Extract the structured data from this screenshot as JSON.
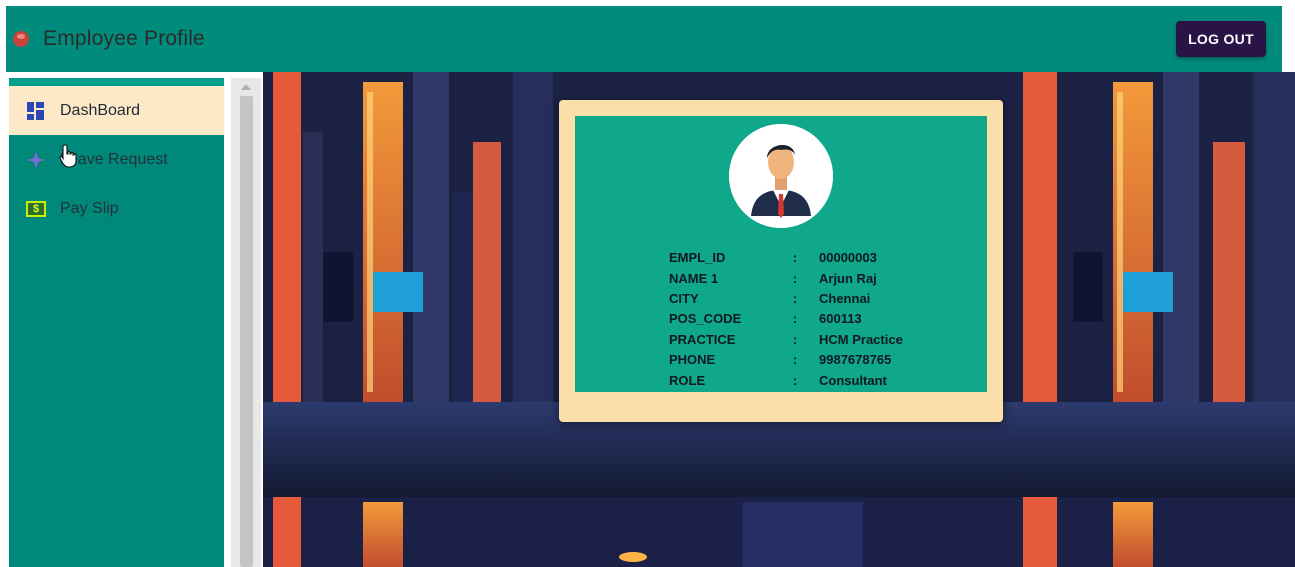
{
  "header": {
    "title": "Employee Profile",
    "app_icon": "profile-logo-icon",
    "logout_label": "LOG OUT"
  },
  "sidebar": {
    "items": [
      {
        "label": "DashBoard",
        "icon": "dashboard-icon",
        "active": true
      },
      {
        "label": "Leave Request",
        "icon": "sparkle-icon",
        "active": false
      },
      {
        "label": "Pay Slip",
        "icon": "dollar-bill-icon",
        "active": false
      }
    ]
  },
  "profile": {
    "separator": ":",
    "fields": [
      {
        "key": "EMPL_ID",
        "value": "00000003"
      },
      {
        "key": "NAME 1",
        "value": "Arjun Raj"
      },
      {
        "key": "CITY",
        "value": "Chennai"
      },
      {
        "key": "POS_CODE",
        "value": "600113"
      },
      {
        "key": "PRACTICE",
        "value": "HCM Practice"
      },
      {
        "key": "PHONE",
        "value": "9987678765"
      },
      {
        "key": "ROLE",
        "value": "Consultant"
      }
    ]
  },
  "colors": {
    "header": "#008c7c",
    "sidebar": "#00897b",
    "active_item": "#fde9c8",
    "logout_button": "#2a1446",
    "card_border": "#fbdfa9",
    "card_fill": "#0fa88b"
  }
}
